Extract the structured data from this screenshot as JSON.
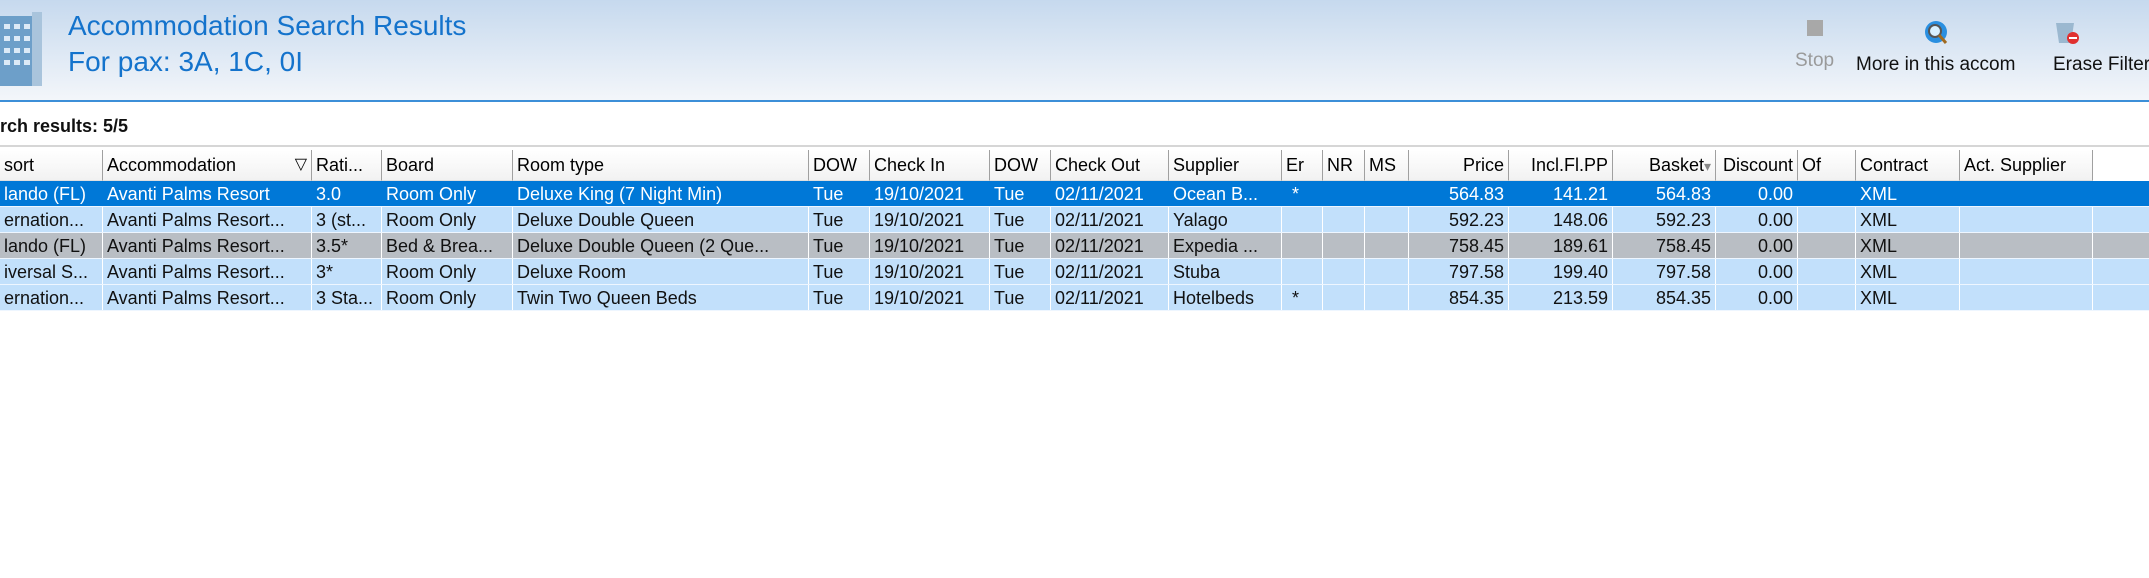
{
  "header": {
    "title": "Accommodation Search Results",
    "subtitle": "For pax: 3A, 1C, 0I"
  },
  "toolbar": {
    "stop": "Stop",
    "more": "More in this accom",
    "erase": "Erase Filter"
  },
  "results_label": "rch results: 5/5",
  "columns": [
    "sort",
    "Accommodation",
    "Rati...",
    "Board",
    "Room type",
    "DOW",
    "Check In",
    "DOW",
    "Check Out",
    "Supplier",
    "Er",
    "NR",
    "MS",
    "Price",
    "Incl.Fl.PP",
    "Basket",
    "Discount",
    "Of",
    "Contract",
    "Act. Supplier"
  ],
  "rows": [
    [
      "lando (FL)",
      "Avanti Palms Resort",
      "3.0",
      "Room Only",
      "Deluxe King (7 Night Min)",
      "Tue",
      "19/10/2021",
      "Tue",
      "02/11/2021",
      "Ocean B...",
      "*",
      "",
      "",
      "564.83",
      "141.21",
      "564.83",
      "0.00",
      "",
      "XML",
      ""
    ],
    [
      "ernation...",
      "Avanti Palms Resort...",
      "3 (st...",
      "Room Only",
      "Deluxe Double Queen",
      "Tue",
      "19/10/2021",
      "Tue",
      "02/11/2021",
      "Yalago",
      "",
      "",
      "",
      "592.23",
      "148.06",
      "592.23",
      "0.00",
      "",
      "XML",
      ""
    ],
    [
      "lando (FL)",
      "Avanti Palms Resort...",
      "3.5*",
      "Bed & Brea...",
      "Deluxe Double Queen (2 Que...",
      "Tue",
      "19/10/2021",
      "Tue",
      "02/11/2021",
      "Expedia ...",
      "",
      "",
      "",
      "758.45",
      "189.61",
      "758.45",
      "0.00",
      "",
      "XML",
      ""
    ],
    [
      "iversal S...",
      "Avanti Palms Resort...",
      "3*",
      "Room Only",
      "Deluxe Room",
      "Tue",
      "19/10/2021",
      "Tue",
      "02/11/2021",
      "Stuba",
      "",
      "",
      "",
      "797.58",
      "199.40",
      "797.58",
      "0.00",
      "",
      "XML",
      ""
    ],
    [
      "ernation...",
      "Avanti Palms Resort...",
      "3 Sta...",
      "Room Only",
      "Twin Two Queen Beds",
      "Tue",
      "19/10/2021",
      "Tue",
      "02/11/2021",
      "Hotelbeds",
      "*",
      "",
      "",
      "854.35",
      "213.59",
      "854.35",
      "0.00",
      "",
      "XML",
      ""
    ]
  ]
}
